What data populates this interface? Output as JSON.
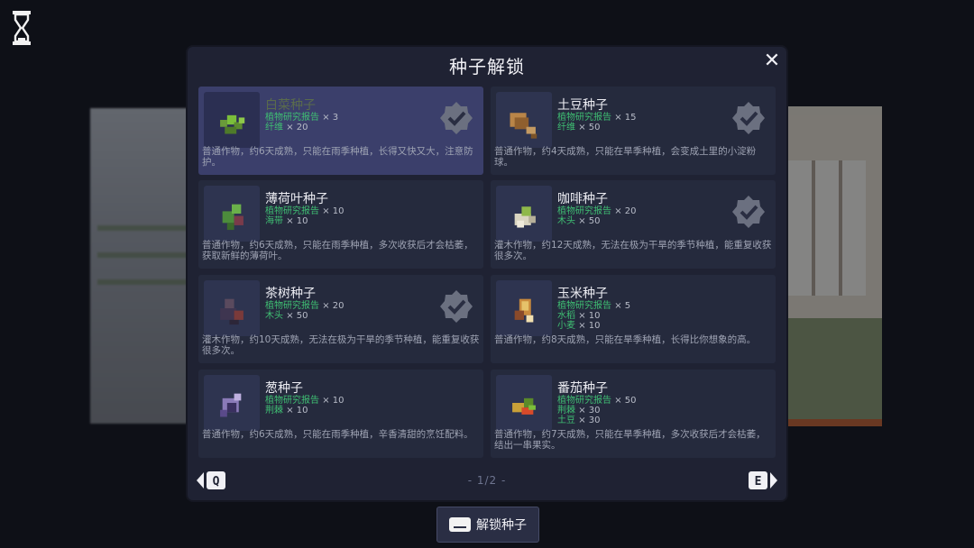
{
  "dialog": {
    "title": "种子解锁",
    "pager": "- 1/2 -",
    "prev_key": "Q",
    "next_key": "E",
    "unlock_label": "解锁种子"
  },
  "seeds": [
    {
      "name": "白菜种子",
      "selected": true,
      "unlocked": true,
      "reqs": [
        {
          "item": "植物研究报告",
          "qty": "× 3"
        },
        {
          "item": "纤维",
          "qty": "× 20"
        }
      ],
      "desc": "普通作物，约6天成熟，只能在雨季种植，长得又快又大，注意防护。"
    },
    {
      "name": "土豆种子",
      "selected": false,
      "unlocked": true,
      "reqs": [
        {
          "item": "植物研究报告",
          "qty": "× 15"
        },
        {
          "item": "纤维",
          "qty": "× 50"
        }
      ],
      "desc": "普通作物，约4天成熟，只能在旱季种植，会变成土里的小淀粉球。"
    },
    {
      "name": "薄荷叶种子",
      "selected": false,
      "unlocked": false,
      "reqs": [
        {
          "item": "植物研究报告",
          "qty": "× 10"
        },
        {
          "item": "海带",
          "qty": "× 10"
        }
      ],
      "desc": "普通作物，约6天成熟，只能在雨季种植，多次收获后才会枯萎，获取新鲜的薄荷叶。"
    },
    {
      "name": "咖啡种子",
      "selected": false,
      "unlocked": true,
      "reqs": [
        {
          "item": "植物研究报告",
          "qty": "× 20"
        },
        {
          "item": "木头",
          "qty": "× 50"
        }
      ],
      "desc": "灌木作物，约12天成熟，无法在极为干旱的季节种植，能重复收获很多次。"
    },
    {
      "name": "茶树种子",
      "selected": false,
      "unlocked": true,
      "reqs": [
        {
          "item": "植物研究报告",
          "qty": "× 20"
        },
        {
          "item": "木头",
          "qty": "× 50"
        }
      ],
      "desc": "灌木作物，约10天成熟，无法在极为干旱的季节种植，能重复收获很多次。"
    },
    {
      "name": "玉米种子",
      "selected": false,
      "unlocked": false,
      "reqs": [
        {
          "item": "植物研究报告",
          "qty": "× 5"
        },
        {
          "item": "水稻",
          "qty": "× 10"
        },
        {
          "item": "小麦",
          "qty": "× 10"
        }
      ],
      "desc": "普通作物，约8天成熟，只能在旱季种植，长得比你想象的高。"
    },
    {
      "name": "葱种子",
      "selected": false,
      "unlocked": false,
      "reqs": [
        {
          "item": "植物研究报告",
          "qty": "× 10"
        },
        {
          "item": "荆棘",
          "qty": "× 10"
        }
      ],
      "desc": "普通作物，约6天成熟，只能在雨季种植，辛香清甜的烹饪配料。"
    },
    {
      "name": "番茄种子",
      "selected": false,
      "unlocked": false,
      "reqs": [
        {
          "item": "植物研究报告",
          "qty": "× 50"
        },
        {
          "item": "荆棘",
          "qty": "× 30"
        },
        {
          "item": "土豆",
          "qty": "× 30"
        }
      ],
      "desc": "普通作物，约7天成熟，只能在旱季种植，多次收获后才会枯萎，结出一串果实。"
    }
  ],
  "icons": [
    "cabbage-seed-icon",
    "potato-seed-icon",
    "mint-seed-icon",
    "coffee-seed-icon",
    "tea-seed-icon",
    "corn-seed-icon",
    "scallion-seed-icon",
    "tomato-seed-icon"
  ],
  "colors": {
    "panel": "#1f2233",
    "card": "#252a3d",
    "selected": "#3b3f6b",
    "req_item": "#3fbf73"
  }
}
